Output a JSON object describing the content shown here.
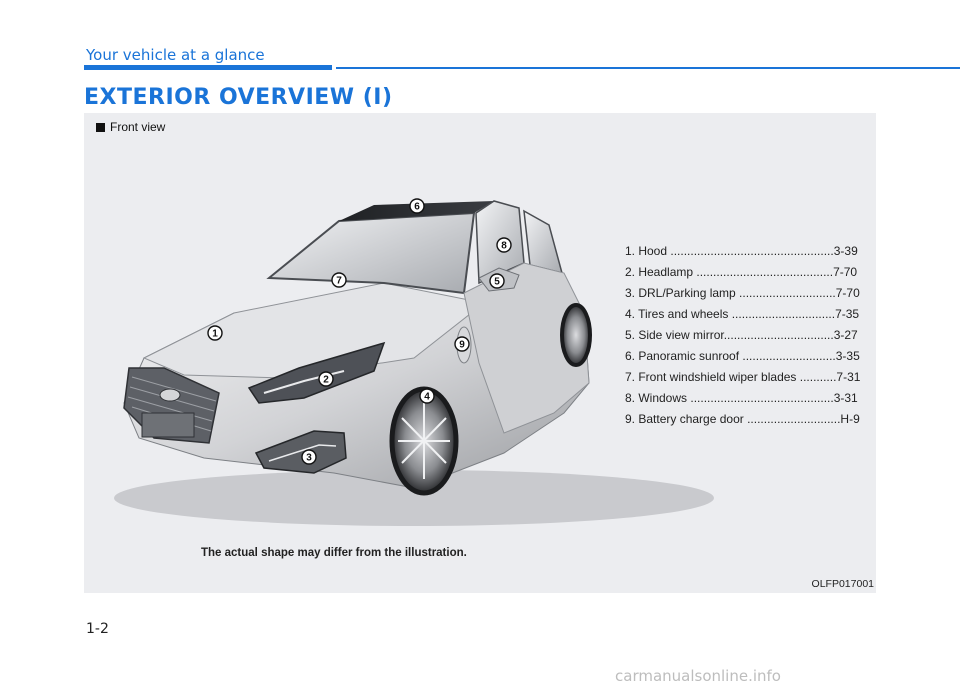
{
  "header": {
    "section": "Your vehicle at a glance",
    "title": "EXTERIOR OVERVIEW (I)"
  },
  "figure": {
    "view_label": "Front view",
    "callouts": [
      "1",
      "2",
      "3",
      "4",
      "5",
      "6",
      "7",
      "8",
      "9"
    ],
    "parts": [
      "1. Hood .................................................3-39",
      "2. Headlamp .........................................7-70",
      "3. DRL/Parking lamp .............................7-70",
      "4. Tires and wheels ...............................7-35",
      "5. Side view mirror.................................3-27",
      "6. Panoramic sunroof ............................3-35",
      "7. Front windshield wiper blades ...........7-31",
      "8. Windows ...........................................3-31",
      "9. Battery charge door ............................H-9"
    ],
    "disclaimer": "The actual shape may differ from the illustration.",
    "image_code": "OLFP017001"
  },
  "page_number": "1-2",
  "watermark": "carmanualsonline.info",
  "colors": {
    "accent": "#1a74d8",
    "panel": "#ecedf0"
  }
}
